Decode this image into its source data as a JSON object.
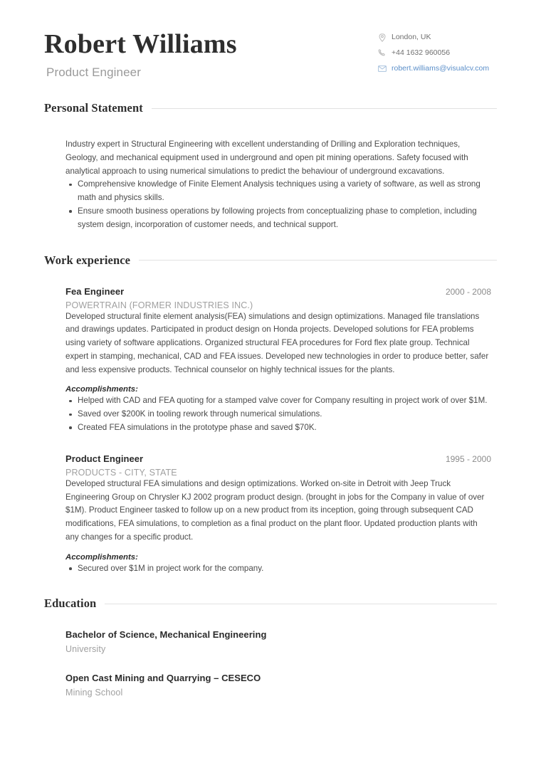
{
  "header": {
    "name": "Robert Williams",
    "role": "Product Engineer",
    "contact": {
      "location": "London, UK",
      "phone": "+44 1632 960056",
      "email": "robert.williams@visualcv.com",
      "location_icon": "map-pin-icon",
      "phone_icon": "phone-icon",
      "email_icon": "envelope-icon",
      "email_color": "#5b8fc9"
    }
  },
  "sections": {
    "personal_statement": {
      "title": "Personal Statement",
      "paragraph": "Industry expert in Structural Engineering with excellent understanding of Drilling and Exploration techniques, Geology, and mechanical equipment used in underground and open pit mining operations. Safety focused with analytical approach to using numerical simulations to predict the behaviour of underground excavations.",
      "bullets": [
        "Comprehensive knowledge of Finite Element Analysis techniques using a variety of software, as well as strong math and physics skills.",
        "Ensure smooth business operations by following projects from conceptualizing phase to completion, including system design, incorporation of customer needs, and technical support."
      ]
    },
    "work_experience": {
      "title": "Work experience",
      "accomplishments_label": "Accomplishments:",
      "entries": [
        {
          "title": "Fea Engineer",
          "dates": "2000 - 2008",
          "organization": "POWERTRAIN (FORMER INDUSTRIES INC.)",
          "description": "Developed structural finite element analysis(FEA) simulations and design optimizations. Managed file translations and drawings updates. Participated in product design on Honda projects. Developed solutions for FEA problems using variety of software applications. Organized structural FEA procedures for Ford flex plate group. Technical expert in stamping, mechanical, CAD and FEA issues. Developed new technologies in order to produce better, safer and less expensive products. Technical counselor on highly technical issues for the plants.",
          "accomplishments": [
            "Helped with CAD and FEA quoting for a stamped valve cover for Company resulting in project work of over $1M.",
            "Saved over $200K in tooling rework through numerical simulations.",
            "Created FEA simulations in the prototype phase and saved $70K."
          ]
        },
        {
          "title": "Product Engineer",
          "dates": "1995 - 2000",
          "organization": "PRODUCTS - CITY, STATE",
          "description": "Developed structural FEA simulations and design optimizations. Worked on-site in Detroit with Jeep Truck Engineering Group on Chrysler KJ 2002 program product design. (brought in jobs for the Company in value of over $1M). Product Engineer tasked to follow up on a new product from its inception, going through subsequent CAD modifications, FEA simulations, to completion as a final product on the plant floor. Updated production plants with any changes for a specific product.",
          "accomplishments": [
            "Secured over $1M in project work for the company."
          ]
        }
      ]
    },
    "education": {
      "title": "Education",
      "entries": [
        {
          "degree": "Bachelor of Science, Mechanical Engineering",
          "school": "University"
        },
        {
          "degree": "Open Cast Mining and Quarrying – CESECO",
          "school": "Mining School"
        }
      ]
    }
  }
}
